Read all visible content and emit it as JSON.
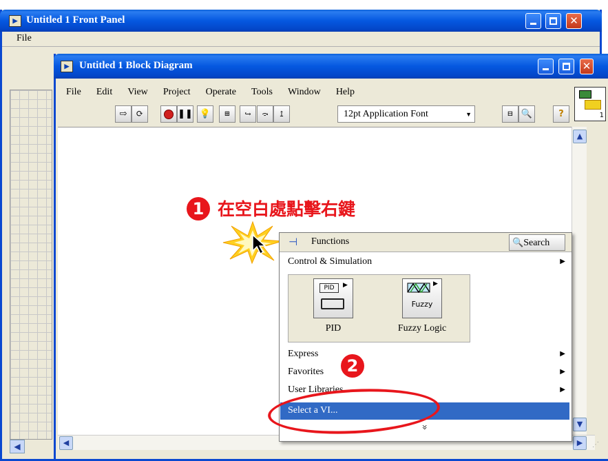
{
  "front_panel": {
    "title": "Untitled 1 Front Panel",
    "menu_file": "File"
  },
  "block_diagram": {
    "title": "Untitled 1 Block Diagram",
    "menu": [
      "File",
      "Edit",
      "View",
      "Project",
      "Operate",
      "Tools",
      "Window",
      "Help"
    ],
    "font_selector": "12pt Application Font"
  },
  "annotation": {
    "step1_number": "1",
    "step1_text": "在空白處點擊右鍵",
    "step2_number": "2"
  },
  "functions_palette": {
    "title": "Functions",
    "search_label": "Search",
    "category": "Control & Simulation",
    "icons": [
      {
        "label": "PID",
        "icon_text": "PID"
      },
      {
        "label": "Fuzzy Logic",
        "icon_text": "Fuzzy"
      }
    ],
    "items": [
      "Express",
      "Favorites",
      "User Libraries",
      "Select a VI..."
    ],
    "selected_item": "Select a VI...",
    "more_glyph": "»"
  },
  "colors": {
    "accent": "#316ac5",
    "annotation_red": "#e8161c",
    "title_blue": "#0558e0"
  }
}
